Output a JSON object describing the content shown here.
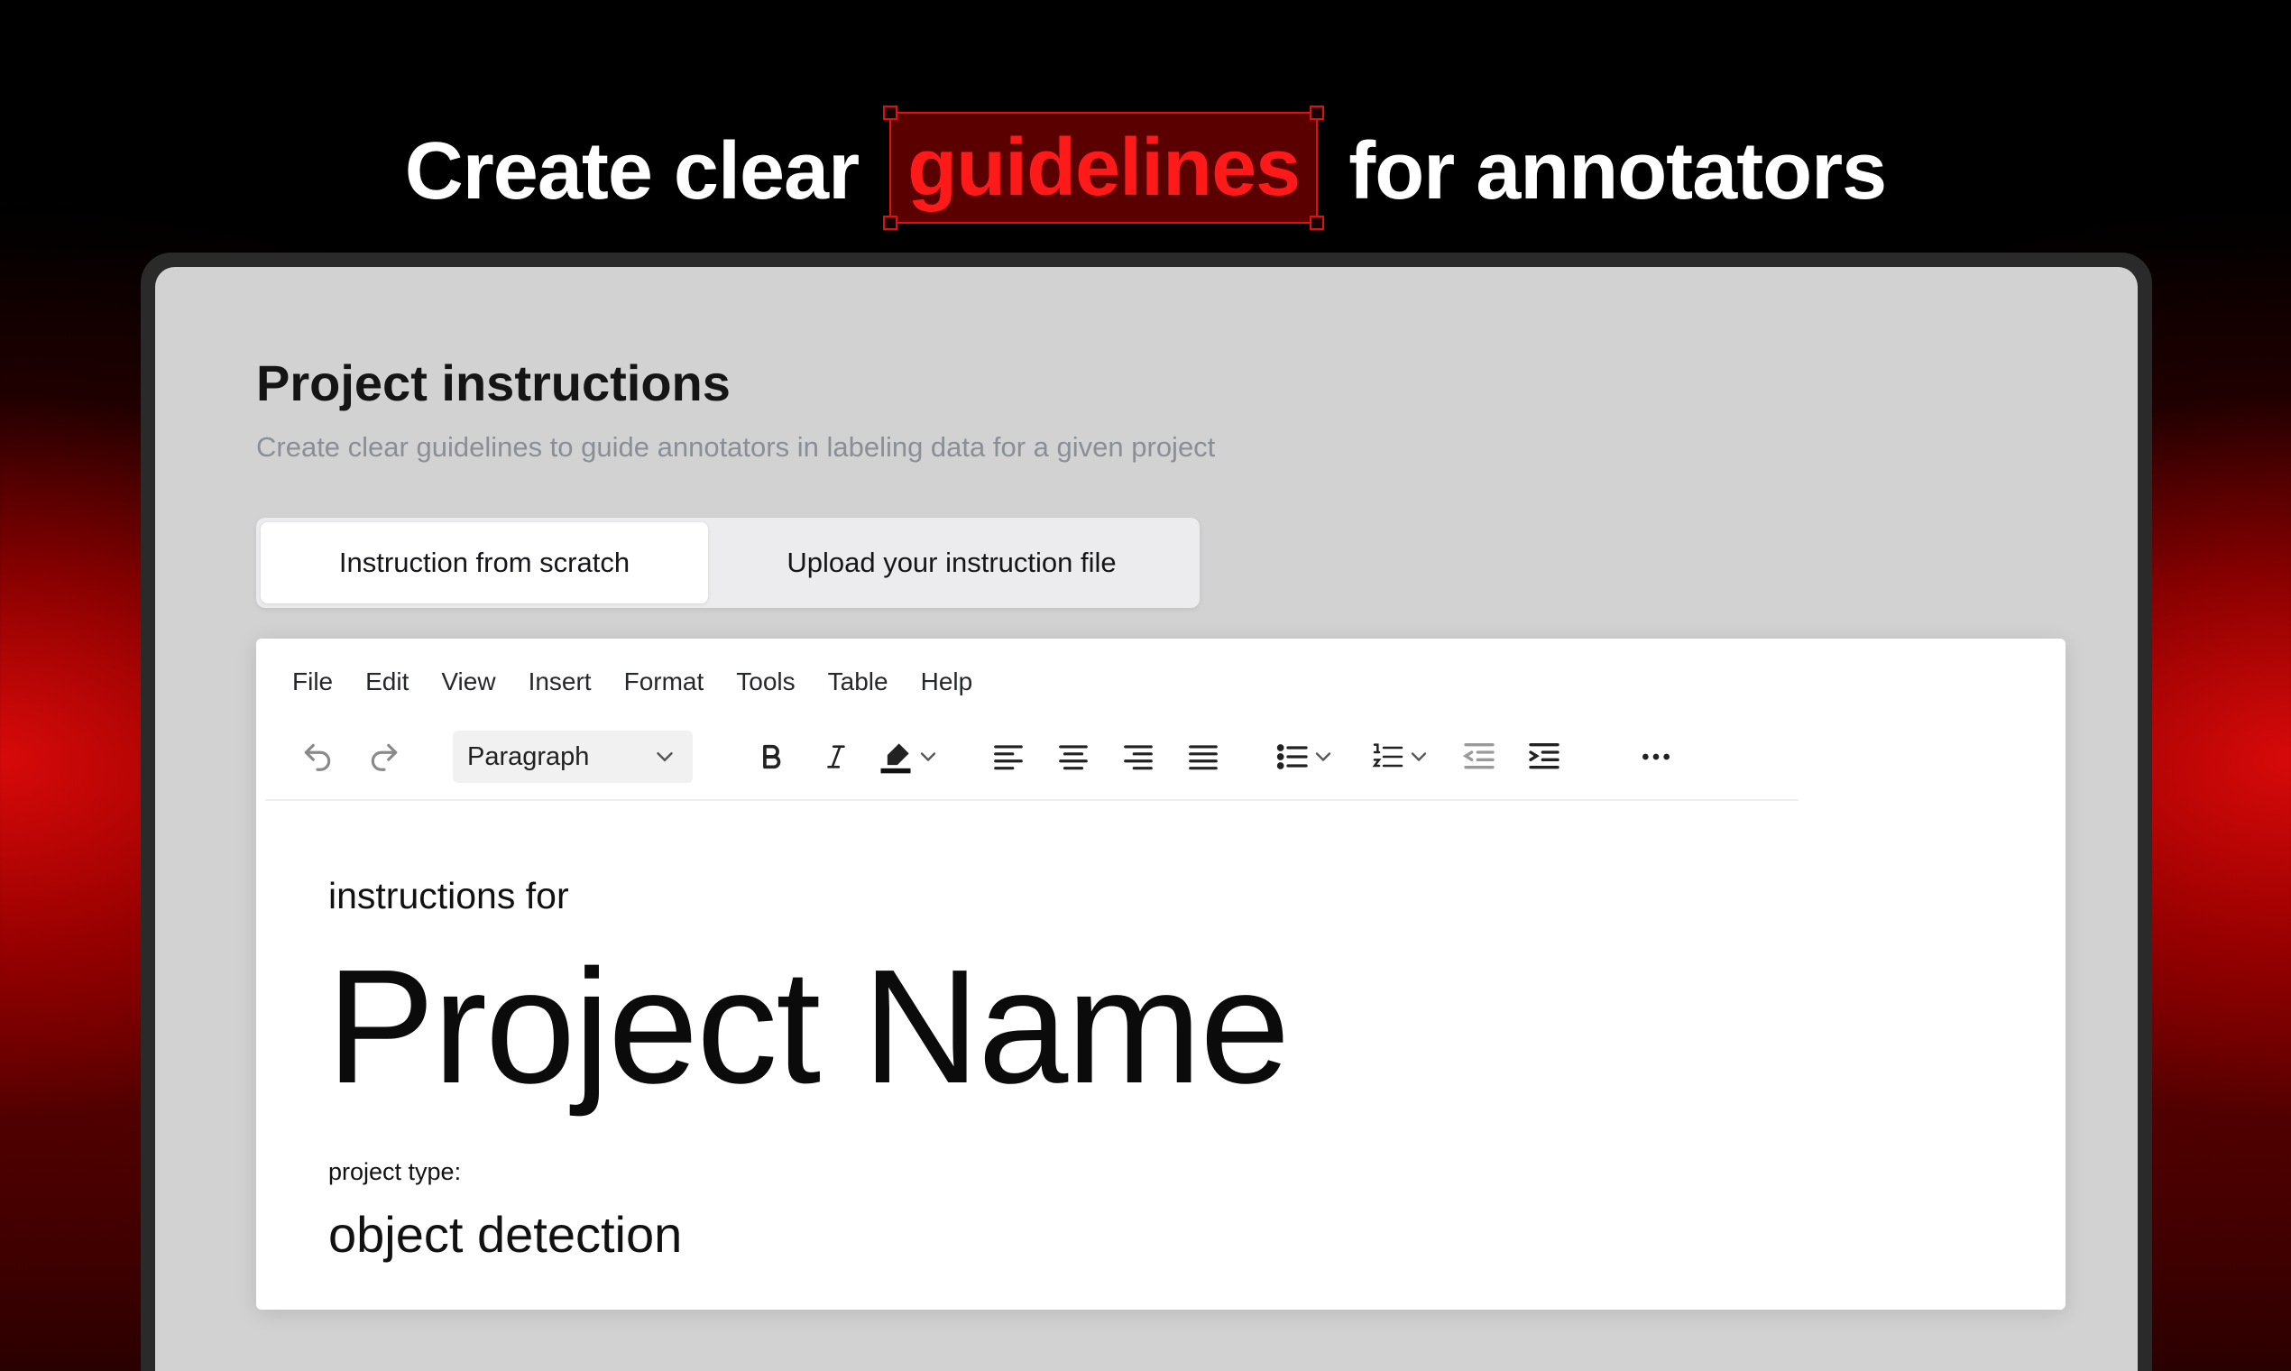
{
  "headline": {
    "before": "Create clear",
    "highlight": "guidelines",
    "after": "for annotators"
  },
  "panel": {
    "title": "Project instructions",
    "subtitle": "Create clear guidelines to guide annotators in labeling data for a given project"
  },
  "tabs": [
    {
      "label": "Instruction from scratch",
      "active": true
    },
    {
      "label": "Upload your instruction file",
      "active": false
    }
  ],
  "menu": [
    "File",
    "Edit",
    "View",
    "Insert",
    "Format",
    "Tools",
    "Table",
    "Help"
  ],
  "toolbar": {
    "block_format": "Paragraph",
    "icons": [
      "undo-icon",
      "redo-icon",
      "chevron-down-icon",
      "bold-icon",
      "italic-icon",
      "highlight-pen-icon",
      "align-left-icon",
      "align-center-icon",
      "align-right-icon",
      "align-justify-icon",
      "bullet-list-icon",
      "numbered-list-icon",
      "outdent-icon",
      "indent-icon",
      "more-icon"
    ]
  },
  "document": {
    "intro": "instructions for",
    "project_name": "Project Name",
    "type_label": "project type:",
    "type_value": "object detection"
  },
  "colors": {
    "accent_red": "#ff1a1a",
    "panel_bg": "#d2d2d2",
    "editor_bg": "#ffffff"
  }
}
